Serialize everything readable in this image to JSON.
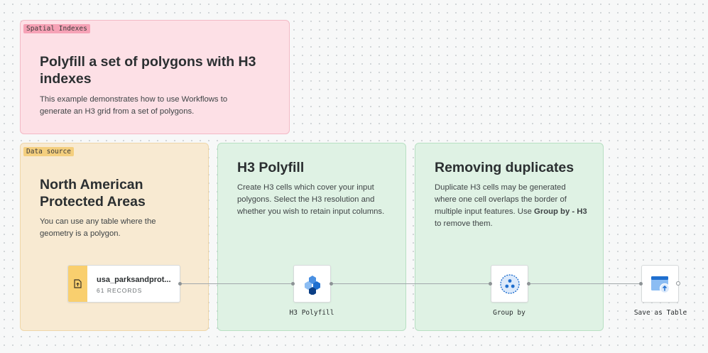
{
  "canvas": {
    "cards": [
      {
        "tag": "Spatial Indexes",
        "title": "Polyfill a set of polygons with H3 indexes",
        "description": "This example demonstrates how to use Workflows to generate an H3 grid from a set of polygons."
      },
      {
        "tag": "Data source",
        "title": "North American Protected Areas",
        "description": "You can use any table where the geometry is a polygon."
      },
      {
        "title": "H3 Polyfill",
        "description": "Create H3 cells which cover your input polygons. Select the H3 resolution and whether you wish to retain input columns."
      },
      {
        "title": "Removing duplicates",
        "description_before": "Duplicate H3 cells may be generated where one cell overlaps the border of multiple input features. Use ",
        "description_bold": "Group by - H3",
        "description_after": " to remove them."
      }
    ]
  },
  "nodes": {
    "source": {
      "name": "usa_parksandprot...",
      "records": "61 RECORDS",
      "icon": "table-upload-icon"
    },
    "h3_polyfill": {
      "label": "H3 Polyfill",
      "icon": "h3-hexagons-icon"
    },
    "group_by": {
      "label": "Group by",
      "icon": "group-by-icon"
    },
    "save_table": {
      "label": "Save as Table",
      "icon": "save-table-icon"
    }
  },
  "colors": {
    "pink": "#fde0e6",
    "tan": "#f8ead2",
    "green": "#dff2e4",
    "h3_blue": "#1f6fcf"
  }
}
